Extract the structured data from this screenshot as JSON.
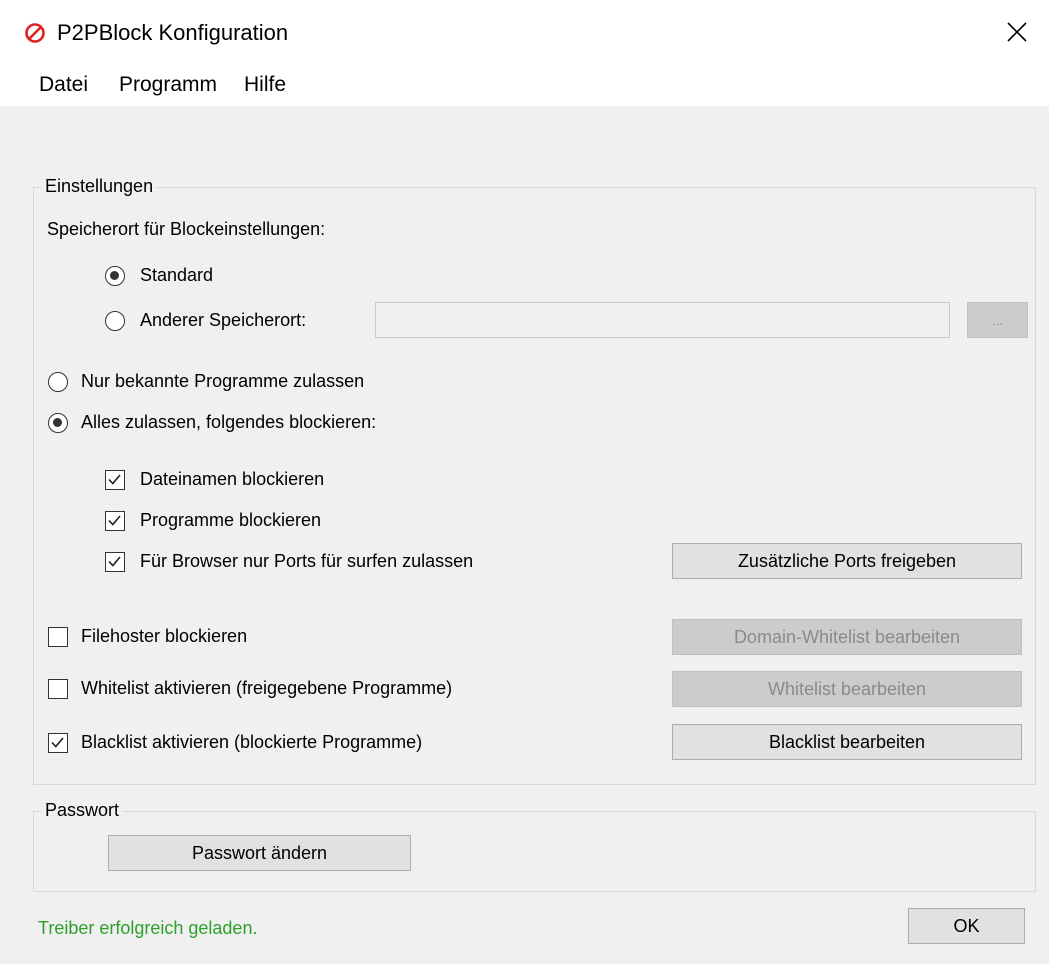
{
  "window": {
    "title": "P2PBlock Konfiguration"
  },
  "menu": [
    "Datei",
    "Programm",
    "Hilfe"
  ],
  "settings": {
    "group_title": "Einstellungen",
    "storage_label": "Speicherort für Blockeinstellungen:",
    "radio_standard": "Standard",
    "radio_other": "Anderer Speicherort:",
    "other_path_value": "",
    "browse_button": "...",
    "radio_known_only": "Nur bekannte Programme zulassen",
    "radio_allow_all": "Alles zulassen, folgendes blockieren:",
    "cb_filenames": "Dateinamen blockieren",
    "cb_programs": "Programme blockieren",
    "cb_browser_ports": "Für Browser nur Ports für surfen zulassen",
    "btn_extra_ports": "Zusätzliche Ports freigeben",
    "cb_filehoster": "Filehoster blockieren",
    "btn_domain_whitelist": "Domain-Whitelist bearbeiten",
    "cb_whitelist": "Whitelist aktivieren (freigegebene Programme)",
    "btn_whitelist": "Whitelist bearbeiten",
    "cb_blacklist": "Blacklist aktivieren (blockierte Programme)",
    "btn_blacklist": "Blacklist bearbeiten"
  },
  "password": {
    "group_title": "Passwort",
    "btn_change": "Passwort ändern"
  },
  "status_text": "Treiber erfolgreich geladen.",
  "ok_button": "OK",
  "colors": {
    "status_green": "#2e9e2e",
    "app_icon_red": "#e02020"
  }
}
